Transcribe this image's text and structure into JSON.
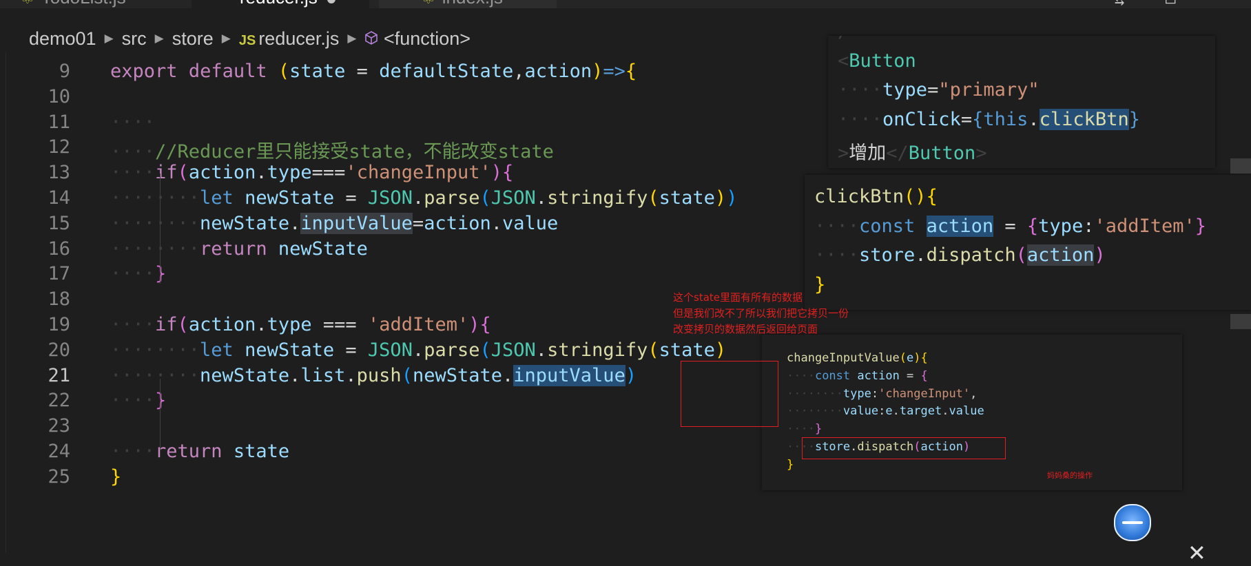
{
  "tabs": [
    {
      "label": "TodoList.js",
      "icon": "react-file-icon"
    },
    {
      "label": "reducer.js",
      "icon": "js-file-icon",
      "active": true
    },
    {
      "label": "index.js",
      "icon": "react-file-icon"
    }
  ],
  "breadcrumb": {
    "items": [
      "demo01",
      "src",
      "store",
      "reducer.js",
      "<function>"
    ],
    "js_badge": "JS"
  },
  "editor": {
    "lines": [
      {
        "n": "9",
        "indent": 0,
        "html": "<span class='kw'>export</span> <span class='kw'>default</span> <span class='br1'>(</span><span class='vr'>state</span> = <span class='vr'>defaultState</span>,<span class='vr'>action</span><span class='br1'>)</span><span class='kb'>=&gt;</span><span class='br1'>{</span>"
      },
      {
        "n": "10",
        "indent": 0,
        "html": ""
      },
      {
        "n": "11",
        "indent": 1,
        "html": ""
      },
      {
        "n": "12",
        "indent": 1,
        "html": "<span class='cmt'>//Reducer里只能接受state，不能改变state</span>"
      },
      {
        "n": "13",
        "indent": 1,
        "html": "<span class='kw'>if</span><span class='br2'>(</span><span class='vr'>action</span>.<span class='vr'>type</span>===<span class='str'>'changeInput'</span><span class='br2'>)</span><span class='br2'>{</span>"
      },
      {
        "n": "14",
        "indent": 2,
        "html": "<span class='kb'>let</span> <span class='vr'>newState</span> = <span class='cls'>JSON</span>.<span class='fn'>parse</span><span class='br3'>(</span><span class='cls'>JSON</span>.<span class='fn'>stringify</span><span class='br1'>(</span><span class='vr'>state</span><span class='br1'>)</span><span class='br3'>)</span>"
      },
      {
        "n": "15",
        "indent": 2,
        "html": "<span class='vr'>newState</span>.<span class='vr hl2'>inputValue</span>=<span class='vr'>action</span>.<span class='vr'>value</span>"
      },
      {
        "n": "16",
        "indent": 2,
        "html": "<span class='kw'>return</span> <span class='vr'>newState</span>"
      },
      {
        "n": "17",
        "indent": 1,
        "html": "<span class='br2'>}</span>"
      },
      {
        "n": "18",
        "indent": 0,
        "html": ""
      },
      {
        "n": "19",
        "indent": 1,
        "html": "<span class='kw'>if</span><span class='br2'>(</span><span class='vr'>action</span>.<span class='vr'>type</span> === <span class='str'>'addItem'</span><span class='br2'>)</span><span class='br2'>{</span>"
      },
      {
        "n": "20",
        "indent": 2,
        "html": "<span class='kb'>let</span> <span class='vr'>newState</span> = <span class='cls'>JSON</span>.<span class='fn'>parse</span><span class='br3'>(</span><span class='cls'>JSON</span>.<span class='fn'>stringify</span><span class='br1'>(</span><span class='vr'>state</span><span class='br1'>)</span>"
      },
      {
        "n": "21",
        "indent": 2,
        "current": true,
        "html": "<span class='vr'>newState</span>.<span class='vr'>list</span>.<span class='fn'>push</span><span class='br3'>(</span><span class='vr'>newState</span>.<span class='vr hl'>inputValue</span><span class='br3'>)</span>"
      },
      {
        "n": "22",
        "indent": 1,
        "html": "<span class='br2'>}</span>"
      },
      {
        "n": "23",
        "indent": 0,
        "html": ""
      },
      {
        "n": "24",
        "indent": 1,
        "html": "<span class='kw'>return</span> <span class='vr'>state</span>"
      },
      {
        "n": "25",
        "indent": 0,
        "html": "<span class='br1'>}</span>"
      }
    ]
  },
  "panel_button": {
    "lines": [
      "<span class='dots'>/&gt;</span>",
      "<span class='dots'>&lt;</span><span class='cls'>Button</span>",
      "<span class='dots'>····</span><span class='vr'>type</span>=<span class='str'>\"primary\"</span>",
      "<span class='dots'>····</span><span class='vr'>onClick</span>=<span class='kb'>{</span><span class='kb'>this</span>.<span class='fn hl'>clickBtn</span><span class='kb'>}</span>",
      "<span class='dots'>&gt;</span>增加<span class='dots'>&lt;/</span><span class='cls'>Button</span><span class='dots'>&gt;</span>"
    ]
  },
  "panel_click": {
    "lines": [
      "<span class='fn'>clickBtn</span><span class='br1'>()</span><span class='br1'>{</span>",
      "<span class='dots'>····</span><span class='kb'>const</span> <span class='vr hl'>action</span> = <span class='br2'>{</span><span class='vr'>type</span>:<span class='str'>'addItem'</span><span class='br2'>}</span>",
      "<span class='dots'>····</span><span class='vr'>store</span>.<span class='fn'>dispatch</span><span class='br2'>(</span><span class='vr hl2'>action</span><span class='br2'>)</span>",
      "<span class='br1'>}</span>"
    ]
  },
  "panel_change": {
    "lines": [
      "<span class='fn'>changeInputValue</span><span class='br1'>(</span><span class='vr'>e</span><span class='br1'>)</span><span class='br1'>{</span>",
      "<span class='dots'>····</span><span class='kb'>const</span> <span class='vr'>action</span> = <span class='br2'>{</span>",
      "<span class='dots'>········</span><span class='vr'>type</span>:<span class='str'>'changeInput'</span>,",
      "<span class='dots'>········</span><span class='vr'>value</span>:<span class='vr'>e</span>.<span class='vr'>target</span>.<span class='vr'>value</span>",
      "<span class='dots'>····</span><span class='br2'>}</span>",
      "<span class='dots'>····</span><span class='vr'>store</span>.<span class='fn'>dispatch</span><span class='br2'>(</span><span class='vr'>action</span><span class='br2'>)</span>",
      "<span class='br1'>}</span>"
    ]
  },
  "annotation": {
    "lines": [
      "这个state里面有所有的数据",
      "但是我们改不了所以我们把它拷贝一份",
      "改变拷贝的数据然后返回给页面"
    ],
    "tiny": "妈妈桑的操作"
  },
  "close_glyph": "✕"
}
